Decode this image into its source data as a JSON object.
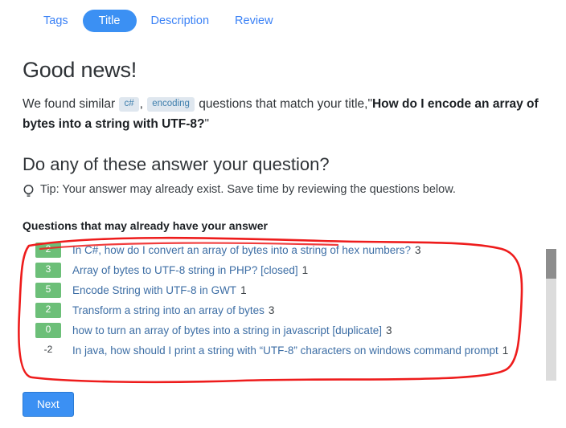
{
  "tabs": [
    {
      "label": "Tags",
      "active": false
    },
    {
      "label": "Title",
      "active": true
    },
    {
      "label": "Description",
      "active": false
    },
    {
      "label": "Review",
      "active": false
    }
  ],
  "heading": {
    "title": "Good news!",
    "subtitle": "Do any of these answer your question?"
  },
  "found": {
    "prefix": "We found similar",
    "tags": [
      "c#",
      "encoding"
    ],
    "separator": ",",
    "middle": "questions that match your title,",
    "quote_open": "\"",
    "your_title": "How do I encode an array of bytes into a string with UTF-8?",
    "quote_close": "\""
  },
  "tip": {
    "icon": "lightbulb-icon",
    "text": "Tip: Your answer may already exist. Save time by reviewing the questions below."
  },
  "questions": {
    "heading": "Questions that may already have your answer",
    "items": [
      {
        "votes": "2",
        "title": "In C#, how do I convert an array of bytes into a string of hex numbers?",
        "answers": "3",
        "negative": false
      },
      {
        "votes": "3",
        "title": "Array of bytes to UTF-8 string in PHP? [closed]",
        "answers": "1",
        "negative": false
      },
      {
        "votes": "5",
        "title": "Encode String with UTF-8 in GWT",
        "answers": "1",
        "negative": false
      },
      {
        "votes": "2",
        "title": "Transform a string into an array of bytes",
        "answers": "3",
        "negative": false
      },
      {
        "votes": "0",
        "title": "how to turn an array of bytes into a string in javascript [duplicate]",
        "answers": "3",
        "negative": false
      },
      {
        "votes": "-2",
        "title": "In java, how should I print a string with “UTF-8” characters on windows command prompt",
        "answers": "1",
        "negative": true
      }
    ]
  },
  "footer": {
    "next_label": "Next"
  },
  "colors": {
    "accent_blue": "#3b90f3",
    "link_blue": "#3d6ea5",
    "vote_green": "#6cbf78",
    "tag_chip_bg": "#dfe7ef",
    "tag_chip_text": "#3f7fad",
    "annotation_red": "#ee1c1c",
    "scrollbar_thumb": "#8d8d8d",
    "scrollbar_track": "#dcdcdc"
  }
}
